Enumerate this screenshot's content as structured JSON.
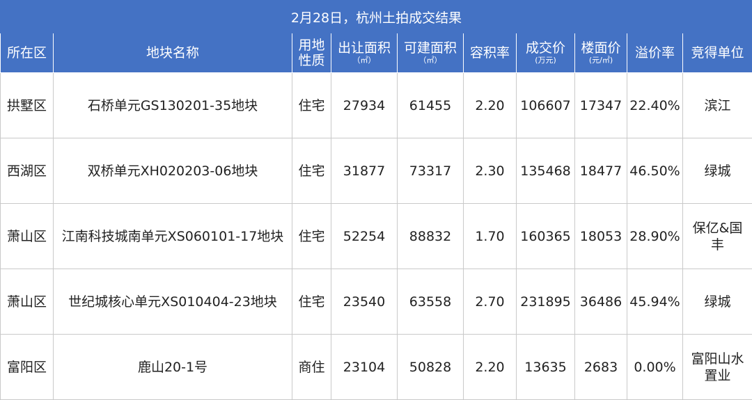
{
  "title": "2月28日，杭州土拍成交结果",
  "headers": [
    {
      "label": "所在区",
      "sub": ""
    },
    {
      "label": "地块名称",
      "sub": ""
    },
    {
      "label": "用地\n性质",
      "sub": ""
    },
    {
      "label": "出让面积",
      "sub": "（㎡）"
    },
    {
      "label": "可建面积",
      "sub": "（㎡）"
    },
    {
      "label": "容积率",
      "sub": ""
    },
    {
      "label": "成交价",
      "sub": "(万元)"
    },
    {
      "label": "楼面价",
      "sub": "(元/㎡)"
    },
    {
      "label": "溢价率",
      "sub": ""
    },
    {
      "label": "竞得单位",
      "sub": ""
    }
  ],
  "rows": [
    [
      "拱墅区",
      "石桥单元GS130201-35地块",
      "住宅",
      "27934",
      "61455",
      "2.20",
      "106607",
      "17347",
      "22.40%",
      "滨江"
    ],
    [
      "西湖区",
      "双桥单元XH020203-06地块",
      "住宅",
      "31877",
      "73317",
      "2.30",
      "135468",
      "18477",
      "46.50%",
      "绿城"
    ],
    [
      "萧山区",
      "江南科技城南单元XS060101-17地块",
      "住宅",
      "52254",
      "88832",
      "1.70",
      "160365",
      "18053",
      "28.90%",
      "保亿&国\n丰"
    ],
    [
      "萧山区",
      "世纪城核心单元XS010404-23地块",
      "住宅",
      "23540",
      "63558",
      "2.70",
      "231895",
      "36486",
      "45.94%",
      "绿城"
    ],
    [
      "富阳区",
      "鹿山20-1号",
      "商住",
      "23104",
      "50828",
      "2.20",
      "13635",
      "2683",
      "0.00%",
      "富阳山水\n置业"
    ]
  ]
}
